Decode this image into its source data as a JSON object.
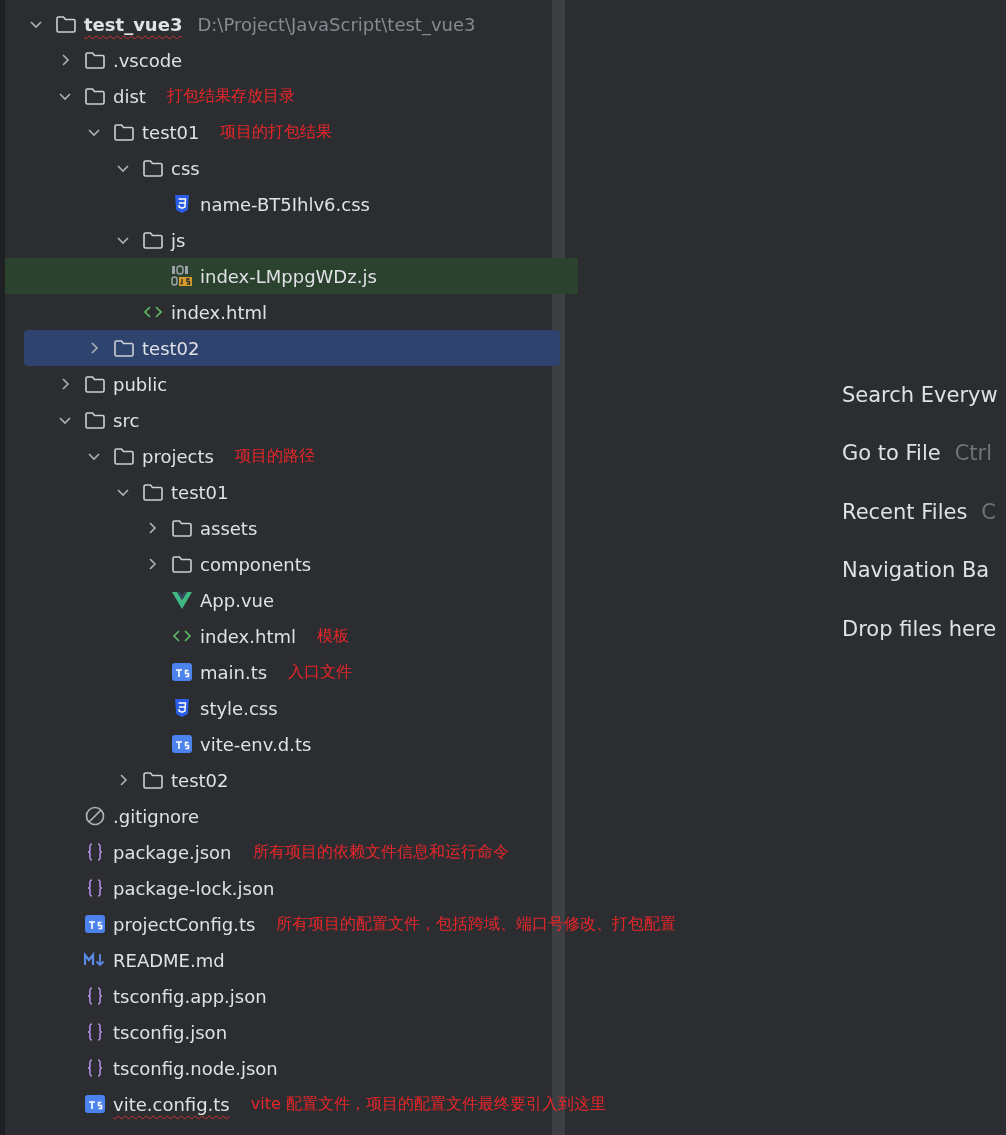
{
  "project": {
    "name": "test_vue3",
    "path": "D:\\Project\\JavaScript\\test_vue3",
    "typo": true,
    "expanded": true,
    "selected": false,
    "highlighted": false,
    "children": [
      {
        "name": ".vscode",
        "kind": "folder",
        "expanded": false,
        "selected": false,
        "highlighted": false,
        "typo": false
      },
      {
        "name": "dist",
        "kind": "folder",
        "expanded": true,
        "selected": false,
        "highlighted": false,
        "typo": false,
        "note": "打包结果存放目录",
        "children": [
          {
            "name": "test01",
            "kind": "folder",
            "expanded": true,
            "selected": false,
            "highlighted": false,
            "typo": false,
            "note": "项目的打包结果",
            "children": [
              {
                "name": "css",
                "kind": "folder",
                "expanded": true,
                "selected": false,
                "highlighted": false,
                "typo": false,
                "children": [
                  {
                    "name": "name-BT5Ihlv6.css",
                    "kind": "css",
                    "selected": false,
                    "highlighted": false,
                    "typo": false
                  }
                ]
              },
              {
                "name": "js",
                "kind": "folder",
                "expanded": true,
                "selected": false,
                "highlighted": false,
                "typo": false,
                "children": [
                  {
                    "name": "index-LMppgWDz.js",
                    "kind": "js",
                    "selected": false,
                    "highlighted": true,
                    "typo": false
                  }
                ]
              },
              {
                "name": "index.html",
                "kind": "html",
                "selected": false,
                "highlighted": false,
                "typo": false
              }
            ]
          },
          {
            "name": "test02",
            "kind": "folder",
            "expanded": false,
            "selected": true,
            "highlighted": false,
            "typo": false
          }
        ]
      },
      {
        "name": "public",
        "kind": "folder",
        "expanded": false,
        "selected": false,
        "highlighted": false,
        "typo": false
      },
      {
        "name": "src",
        "kind": "folder",
        "expanded": true,
        "selected": false,
        "highlighted": false,
        "typo": false,
        "children": [
          {
            "name": "projects",
            "kind": "folder",
            "expanded": true,
            "selected": false,
            "highlighted": false,
            "typo": false,
            "note": "项目的路径",
            "children": [
              {
                "name": "test01",
                "kind": "folder",
                "expanded": true,
                "selected": false,
                "highlighted": false,
                "typo": false,
                "children": [
                  {
                    "name": "assets",
                    "kind": "folder",
                    "expanded": false,
                    "selected": false,
                    "highlighted": false,
                    "typo": false
                  },
                  {
                    "name": "components",
                    "kind": "folder",
                    "expanded": false,
                    "selected": false,
                    "highlighted": false,
                    "typo": false
                  },
                  {
                    "name": "App.vue",
                    "kind": "vue",
                    "selected": false,
                    "highlighted": false,
                    "typo": false
                  },
                  {
                    "name": "index.html",
                    "kind": "html",
                    "selected": false,
                    "highlighted": false,
                    "typo": false,
                    "note": "模板"
                  },
                  {
                    "name": "main.ts",
                    "kind": "ts",
                    "selected": false,
                    "highlighted": false,
                    "typo": false,
                    "note": "入口文件"
                  },
                  {
                    "name": "style.css",
                    "kind": "css",
                    "selected": false,
                    "highlighted": false,
                    "typo": false
                  },
                  {
                    "name": "vite-env.d.ts",
                    "kind": "ts",
                    "selected": false,
                    "highlighted": false,
                    "typo": false
                  }
                ]
              },
              {
                "name": "test02",
                "kind": "folder",
                "expanded": false,
                "selected": false,
                "highlighted": false,
                "typo": false
              }
            ]
          }
        ]
      },
      {
        "name": ".gitignore",
        "kind": "ignore",
        "selected": false,
        "highlighted": false,
        "typo": false
      },
      {
        "name": "package.json",
        "kind": "json",
        "selected": false,
        "highlighted": false,
        "typo": false,
        "note": "所有项目的依赖文件信息和运行命令"
      },
      {
        "name": "package-lock.json",
        "kind": "json",
        "selected": false,
        "highlighted": false,
        "typo": false
      },
      {
        "name": "projectConfig.ts",
        "kind": "ts",
        "selected": false,
        "highlighted": false,
        "typo": false,
        "note": "所有项目的配置文件，包括跨域、端口号修改、打包配置"
      },
      {
        "name": "README.md",
        "kind": "md",
        "selected": false,
        "highlighted": false,
        "typo": false
      },
      {
        "name": "tsconfig.app.json",
        "kind": "json",
        "selected": false,
        "highlighted": false,
        "typo": false
      },
      {
        "name": "tsconfig.json",
        "kind": "json",
        "selected": false,
        "highlighted": false,
        "typo": false
      },
      {
        "name": "tsconfig.node.json",
        "kind": "json",
        "selected": false,
        "highlighted": false,
        "typo": false
      },
      {
        "name": "vite.config.ts",
        "kind": "ts",
        "selected": false,
        "highlighted": false,
        "typo": true,
        "note": "vite 配置文件，项目的配置文件最终要引入到这里"
      }
    ]
  },
  "editor_hints": [
    {
      "label": "Search Everyw"
    },
    {
      "label": "Go to File",
      "shortcut": "Ctrl"
    },
    {
      "label": "Recent Files",
      "shortcut": "C"
    },
    {
      "label": "Navigation Ba"
    },
    {
      "label": "Drop files here"
    }
  ]
}
